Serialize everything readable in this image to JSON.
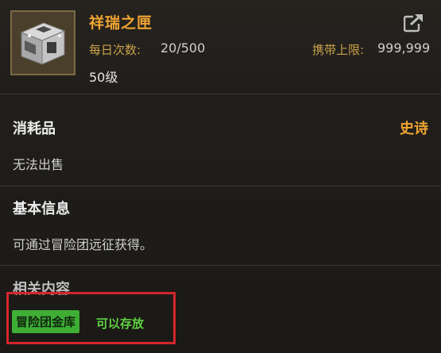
{
  "item": {
    "name": "祥瑞之匣",
    "daily_label": "每日次数:",
    "daily_value": "20/500",
    "carry_label": "携带上限:",
    "carry_value": "999,999",
    "level": "50级",
    "icon": "chest-icon",
    "share_icon": "share-icon"
  },
  "category": {
    "type": "消耗品",
    "rarity": "史诗",
    "sell_status": "无法出售"
  },
  "basic_info": {
    "title": "基本信息",
    "description": "可通过冒险团远征获得。"
  },
  "related": {
    "title": "相关内容",
    "badge": "冒险团金库",
    "note": "可以存放"
  },
  "colors": {
    "accent": "#f0a531",
    "badge_bg": "#3fae35",
    "note": "#5fd241",
    "highlight": "#d5262b"
  }
}
